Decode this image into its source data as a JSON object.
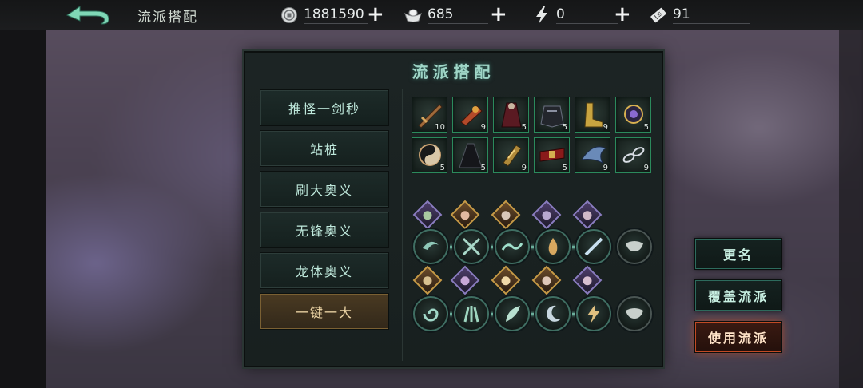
{
  "topbar": {
    "title": "流派搭配",
    "back_icon": "back-arrow-icon",
    "resources": [
      {
        "icon": "coin-icon",
        "value": "1881590"
      },
      {
        "icon": "ingot-icon",
        "value": "685"
      },
      {
        "icon": "lightning-icon",
        "value": "0"
      },
      {
        "icon": "ticket-icon",
        "value": "91"
      }
    ]
  },
  "panel": {
    "title": "流派搭配",
    "tabs": [
      "推怪一剑秒",
      "站桩",
      "刷大奥义",
      "无锋奥义",
      "龙体奥义",
      "一键一大"
    ],
    "active_tab": 5,
    "equipment": [
      {
        "level": "10",
        "icon": "sword-icon"
      },
      {
        "level": "9",
        "icon": "gauntlet-icon"
      },
      {
        "level": "5",
        "icon": "robe-icon"
      },
      {
        "level": "5",
        "icon": "armor-icon"
      },
      {
        "level": "9",
        "icon": "boots-icon"
      },
      {
        "level": "5",
        "icon": "amulet-icon"
      },
      {
        "level": "5",
        "icon": "yinyang-icon"
      },
      {
        "level": "5",
        "icon": "cloak-icon"
      },
      {
        "level": "9",
        "icon": "bracer-icon"
      },
      {
        "level": "5",
        "icon": "belt-icon"
      },
      {
        "level": "9",
        "icon": "wing-icon"
      },
      {
        "level": "9",
        "icon": "chain-icon"
      }
    ]
  },
  "buttons": {
    "rename": "更名",
    "overwrite": "覆盖流派",
    "use": "使用流派"
  },
  "colors": {
    "accent": "#9fd6c7",
    "frame": "#2b8a5c",
    "use_button": "#c24a24",
    "active_tab": "#7a6033"
  }
}
